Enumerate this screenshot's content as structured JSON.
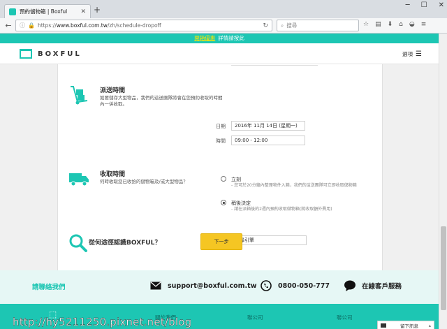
{
  "browser": {
    "tab_title": "預約儲物箱 | Boxful",
    "url_prefix": "https://",
    "url_host": "www.boxful.com.tw",
    "url_path": "/zh/schedule-dropoff",
    "search_placeholder": "搜尋"
  },
  "promo": {
    "link_text": "開箱優惠",
    "text": "詳情請按此"
  },
  "header": {
    "logo": "BOXFUL",
    "menu_label": "選項"
  },
  "delivery": {
    "title": "派送時間",
    "description": "如要儲存大型物品，我們的這送團隊將會在您預約收取的時間內一併收取。",
    "date_label": "日期",
    "date_value": "2016年 11月 14日 (星期一)",
    "time_label": "時間",
    "time_value": "09:00 - 12:00"
  },
  "pickup": {
    "title": "收取時間",
    "description": "何時收取您已收拾的儲物箱及/或大型物品？",
    "options": [
      {
        "label": "立刻",
        "note": "- 您可於20分鐘內整理物件入箱，我們的這送團隊可立即收取儲物箱",
        "checked": false
      },
      {
        "label": "稍後決定",
        "note": "- 請在派箱後的2週內預約收取儲物箱(將收取額外費用)",
        "checked": true
      }
    ]
  },
  "referral": {
    "title": "從何途徑認識BOXFUL？",
    "value": "搜尋引擎"
  },
  "next_button": "下一步",
  "contact": {
    "title": "請聯絡我們",
    "email": "support@boxful.com.tw",
    "phone": "0800-050-777",
    "chat": "在線客戶服務"
  },
  "footer": {
    "col1": "關於我們",
    "col2": "聯公司",
    "col3": "聯公司",
    "chat_label": "留下訊息"
  },
  "watermark": "http://hy5211250.pixnet.net/blog",
  "colors": {
    "accent": "#1dc6b3",
    "button": "#f5c623",
    "promo_link": "#ffe600"
  }
}
